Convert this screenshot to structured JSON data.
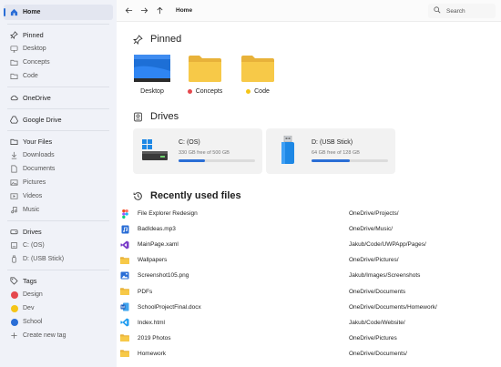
{
  "sidebar": {
    "home": "Home",
    "pinned": {
      "label": "Pinned",
      "items": [
        "Desktop",
        "Concepts",
        "Code"
      ]
    },
    "onedrive": "OneDrive",
    "googledrive": "Google Drive",
    "yourfiles": {
      "label": "Your Files",
      "items": [
        "Downloads",
        "Documents",
        "Pictures",
        "Videos",
        "Music"
      ]
    },
    "drives": {
      "label": "Drives",
      "items": [
        "C: (OS)",
        "D: (USB Stick)"
      ]
    },
    "tags": {
      "label": "Tags",
      "items": [
        {
          "label": "Design",
          "color": "#e5484d"
        },
        {
          "label": "Dev",
          "color": "#f5c518"
        },
        {
          "label": "School",
          "color": "#2a6ed6"
        }
      ],
      "create": "Create new tag"
    }
  },
  "toolbar": {
    "address": "Home",
    "search_placeholder": "Search"
  },
  "pinned": {
    "title": "Pinned",
    "items": [
      {
        "label": "Desktop",
        "icon": "desktop-icon",
        "tag_color": ""
      },
      {
        "label": "Concepts",
        "icon": "folder-icon",
        "tag_color": "#e5484d"
      },
      {
        "label": "Code",
        "icon": "folder-icon",
        "tag_color": "#f5c518"
      }
    ]
  },
  "drives": {
    "title": "Drives",
    "items": [
      {
        "name": "C: (OS)",
        "free": "330 GB free of 500 GB",
        "used_fraction": 0.34,
        "icon": "hard-drive-icon"
      },
      {
        "name": "D: (USB Stick)",
        "free": "64 GB free of 128 GB",
        "used_fraction": 0.5,
        "icon": "usb-stick-icon"
      }
    ]
  },
  "recent": {
    "title": "Recently used files",
    "files": [
      {
        "name": "File Explorer Redesign",
        "path": "OneDrive/Projects/",
        "icon": "figma-icon"
      },
      {
        "name": "BadIdeas.mp3",
        "path": "OneDrive/Music/",
        "icon": "audio-file-icon"
      },
      {
        "name": "MainPage.xaml",
        "path": "Jakub/Code/UWPApp/Pages/",
        "icon": "visual-studio-icon"
      },
      {
        "name": "Wallpapers",
        "path": "OneDrive/Pictures/",
        "icon": "folder-icon"
      },
      {
        "name": "Screenshot105.png",
        "path": "Jakub/Images/Screenshots",
        "icon": "image-file-icon"
      },
      {
        "name": "PDFs",
        "path": "OneDrive/Documents",
        "icon": "folder-icon"
      },
      {
        "name": "SchoolProjectFinal.docx",
        "path": "OneDrive/Documents/Homework/",
        "icon": "word-icon"
      },
      {
        "name": "Index.html",
        "path": "Jakub/Code/Website/",
        "icon": "vscode-icon"
      },
      {
        "name": "2019 Photos",
        "path": "OneDrive/Pictures",
        "icon": "folder-icon"
      },
      {
        "name": "Homework",
        "path": "OneDrive/Documents/",
        "icon": "folder-icon"
      }
    ]
  },
  "colors": {
    "accent": "#2a6ed6",
    "folder": "#f7c948",
    "sidebar_bg": "#f0f2f8"
  }
}
